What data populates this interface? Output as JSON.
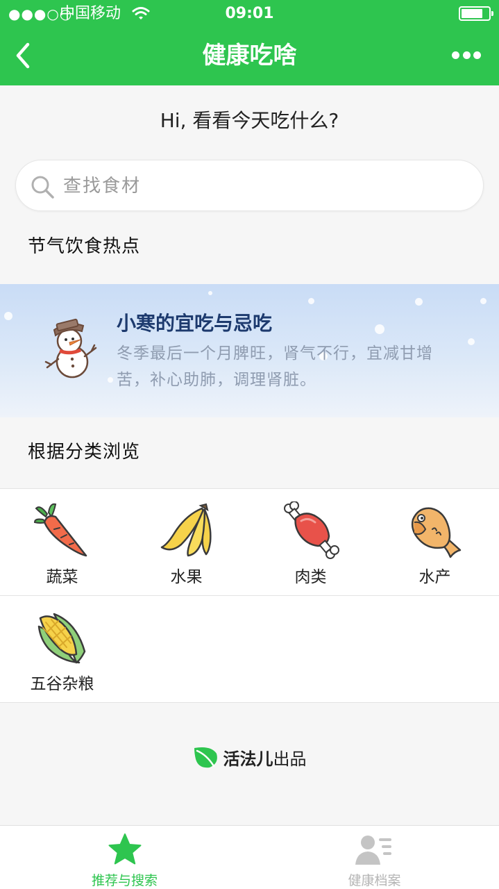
{
  "status_bar": {
    "signal": "●●●○○",
    "carrier": "中国移动",
    "time": "09:01"
  },
  "nav": {
    "title": "健康吃啥",
    "back_icon": "chevron-left-icon",
    "more_icon": "more-dots-icon"
  },
  "greeting": "Hi, 看看今天吃什么?",
  "search": {
    "placeholder": "查找食材",
    "value": ""
  },
  "solar_term": {
    "section_title": "节气饮食热点",
    "banner_title": "小寒的宜吃与忌吃",
    "banner_desc": "冬季最后一个月脾旺，肾气不行，宜减甘增苦，补心助肺，调理肾脏。",
    "icon": "snowman-icon"
  },
  "categories": {
    "section_title": "根据分类浏览",
    "items": [
      {
        "label": "蔬菜",
        "icon": "carrot-icon"
      },
      {
        "label": "水果",
        "icon": "banana-icon"
      },
      {
        "label": "肉类",
        "icon": "meat-icon"
      },
      {
        "label": "水产",
        "icon": "fish-icon"
      },
      {
        "label": "五谷杂粮",
        "icon": "corn-icon"
      }
    ]
  },
  "brand": {
    "name": "活法儿",
    "suffix": "出品",
    "icon": "leaf-icon"
  },
  "tabbar": {
    "tabs": [
      {
        "label": "推荐与搜索",
        "icon": "star-icon",
        "active": true
      },
      {
        "label": "健康档案",
        "icon": "profile-list-icon",
        "active": false
      }
    ]
  },
  "colors": {
    "primary_green": "#2ec54f",
    "inactive_gray": "#b5b5b5",
    "banner_title": "#1d3a6e"
  }
}
